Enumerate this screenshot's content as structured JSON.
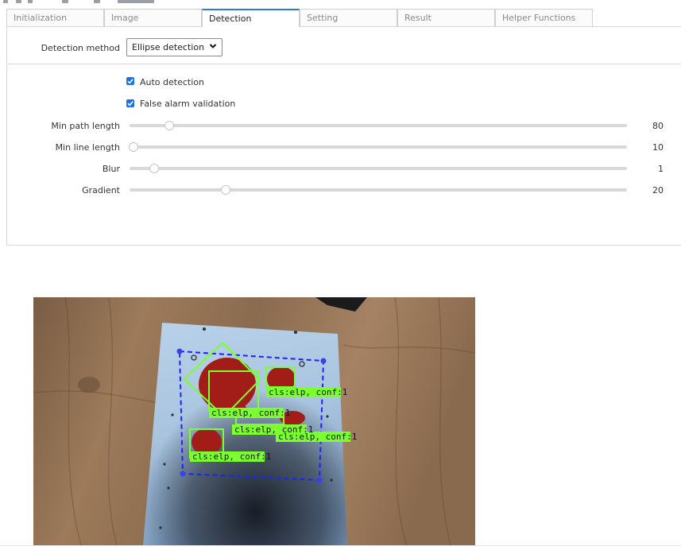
{
  "tabs": [
    "Initialization",
    "Image",
    "Detection",
    "Setting",
    "Result",
    "Helper Functions"
  ],
  "active_tab": "Detection",
  "detection_method": {
    "label": "Detection method",
    "value": "Ellipse detection"
  },
  "checkboxes": [
    {
      "label": "Auto detection",
      "checked": true
    },
    {
      "label": "False alarm validation",
      "checked": true
    }
  ],
  "sliders": [
    {
      "label": "Min path length",
      "value": "80",
      "level": 0.08
    },
    {
      "label": "Min line length",
      "value": "10",
      "level": 0.008
    },
    {
      "label": "Blur",
      "value": "1",
      "level": 0.05
    },
    {
      "label": "Gradient",
      "value": "20",
      "level": 0.193
    }
  ],
  "detections": [
    {
      "label": "cls:elp, conf:1"
    },
    {
      "label": "cls:elp, conf:1"
    },
    {
      "label": "cls:elp, conf:1"
    },
    {
      "label": "cls:elp, conf:1"
    },
    {
      "label": "cls:elp, conf:1"
    }
  ],
  "colors": {
    "accent": "#2e7bcf",
    "checkbox": "#1a73e8",
    "detection_box": "#7cff2e",
    "region_outline": "#1c23ff",
    "target_fill": "#b51f1a"
  },
  "icons": [
    "chevron-down-icon",
    "check-icon"
  ]
}
